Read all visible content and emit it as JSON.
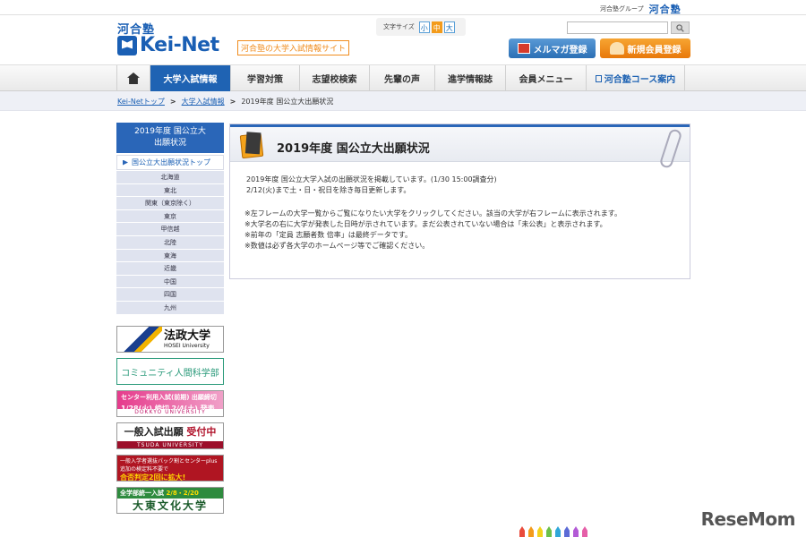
{
  "header": {
    "group_text": "河合塾グループ",
    "group_logo": "河合塾",
    "logo_small": "河合塾",
    "logo_main": "Kei-Net",
    "tagline": "河合塾の大学入試情報サイト",
    "fontsize_label": "文字サイズ",
    "fontsize_options": [
      "小",
      "中",
      "大"
    ],
    "search_placeholder": "",
    "mail_button": "メルマガ登録",
    "register_button": "新規会員登録"
  },
  "nav": {
    "items": [
      {
        "label": "大学入試情報"
      },
      {
        "label": "学習対策"
      },
      {
        "label": "志望校検索"
      },
      {
        "label": "先輩の声"
      },
      {
        "label": "進学情報誌"
      },
      {
        "label": "会員メニュー"
      },
      {
        "label": "河合塾コース案内"
      }
    ],
    "active_index": 0
  },
  "breadcrumb": {
    "items": [
      "Kei-Netトップ",
      "大学入試情報",
      "2019年度 国公立大出願状況"
    ]
  },
  "sidebar": {
    "title_line1": "2019年度 国公立大",
    "title_line2": "出願状況",
    "top_link": "国公立大出願状況トップ",
    "regions": [
      "北海道",
      "東北",
      "関東（東京除く）",
      "東京",
      "甲信越",
      "北陸",
      "東海",
      "近畿",
      "中国",
      "四国",
      "九州"
    ]
  },
  "banners": {
    "hosei": {
      "name": "法政大学",
      "sub": "HOSEI University"
    },
    "community": {
      "name": "コミュニティ人間科学部"
    },
    "dokkyo": {
      "line1": "センター利用入試(前期) 出願締切",
      "line2": "1/28(火) 締切 2/4(土) 発表",
      "footer": "DOKKYO UNIVERSITY"
    },
    "tsuda": {
      "line1_a": "一般入試出願",
      "line1_b": "受付中",
      "footer": "TSUDA UNIVERSITY"
    },
    "kaisei": {
      "line1": "一般入学者選抜パック割とセンターplus",
      "line2": "合否判定2回に拡大!",
      "line3": "追加の検定料不要で"
    },
    "daito": {
      "line1_a": "全学部統一入試",
      "line1_b": "2/8・2/20",
      "line2": "大東文化大学"
    }
  },
  "panel": {
    "title": "2019年度 国公立大出願状況",
    "lines": [
      "2019年度 国公立大学入試の出願状況を掲載しています。(1/30 15:00調査分)",
      "2/12(火)まで土・日・祝日を除き毎日更新します。"
    ],
    "notes": [
      "※左フレームの大学一覧からご覧になりたい大学をクリックしてください。該当の大学が右フレームに表示されます。",
      "※大学名の右に大学が発表した日時が示されています。まだ公表されていない場合は「未公表」と表示されます。",
      "※前年の「定員 志願者数 倍率」は最終データです。",
      "※数値は必ず各大学のホームページ等でご確認ください。"
    ]
  },
  "watermark": "ReseMom",
  "colors": {
    "brand_blue": "#1a5fb4",
    "nav_active": "#1f63b3",
    "accent_orange": "#f39b1b"
  }
}
